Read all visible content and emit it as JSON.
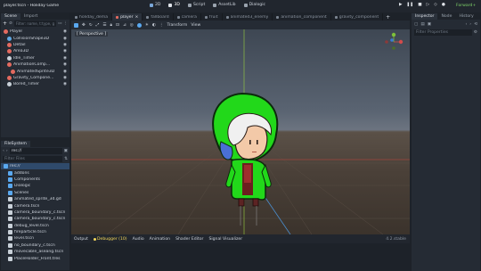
{
  "window": {
    "title": "player.tscn - Holiday Game",
    "center_tabs": [
      "2D",
      "3D",
      "Script",
      "AssetLib",
      "Dialogic"
    ],
    "renderer": "Forward+"
  },
  "scene_dock": {
    "tabs": [
      "Scene",
      "Import"
    ],
    "filter_placeholder": "Filter: name, t:type, g",
    "nodes": [
      {
        "label": "Player",
        "color": "#e46a5f",
        "level": 0
      },
      {
        "label": "CollisionShape3D",
        "color": "#5fa8e4",
        "level": 1
      },
      {
        "label": "Detail",
        "color": "#e46a5f",
        "level": 1
      },
      {
        "label": "Area3D",
        "color": "#e46a5f",
        "level": 1
      },
      {
        "label": "Idle_Timer",
        "color": "#c9d1d9",
        "level": 1
      },
      {
        "label": "AnimationComp...",
        "color": "#e46a5f",
        "level": 1
      },
      {
        "label": "AnimatedSprite3D",
        "color": "#e46a5f",
        "level": 2
      },
      {
        "label": "Gravity_Compone...",
        "color": "#e46a5f",
        "level": 1
      },
      {
        "label": "Bored_Timer",
        "color": "#c9d1d9",
        "level": 1
      }
    ]
  },
  "filesystem": {
    "title": "FileSystem",
    "path": "res://",
    "filter_placeholder": "Filter Files",
    "items": [
      {
        "label": "res://",
        "type": "folder",
        "level": 0,
        "selected": true
      },
      {
        "label": "addons",
        "type": "folder",
        "level": 1
      },
      {
        "label": "Components",
        "type": "folder",
        "level": 1
      },
      {
        "label": "Dialogic",
        "type": "folder",
        "level": 1
      },
      {
        "label": "Scenes",
        "type": "folder",
        "level": 1
      },
      {
        "label": "animated_sprite_3d.gd",
        "type": "file",
        "level": 1
      },
      {
        "label": "camera.tscn",
        "type": "file",
        "level": 1
      },
      {
        "label": "camera_boundary_c.tscn",
        "type": "file",
        "level": 1
      },
      {
        "label": "camera_boundary_c.tscn",
        "type": "file",
        "level": 1
      },
      {
        "label": "debug_level.tscn",
        "type": "file",
        "level": 1
      },
      {
        "label": "fireparticle.tscn",
        "type": "file",
        "level": 1
      },
      {
        "label": "level.tscn",
        "type": "file",
        "level": 1
      },
      {
        "label": "no_boundary_c.tscn",
        "type": "file",
        "level": 1
      },
      {
        "label": "movecable_aseang.tscn",
        "type": "file",
        "level": 1
      },
      {
        "label": "PlaceHolder_Front.tres",
        "type": "file",
        "level": 1
      }
    ]
  },
  "editor_tabs": [
    {
      "label": "holiday_dema",
      "active": false
    },
    {
      "label": "player",
      "active": true
    },
    {
      "label": "fallboard",
      "active": false
    },
    {
      "label": "camera",
      "active": false
    },
    {
      "label": "fruit",
      "active": false
    },
    {
      "label": "animated3_enemy",
      "active": false
    },
    {
      "label": "animation_component",
      "active": false
    },
    {
      "label": "gravity_component",
      "active": false
    }
  ],
  "viewport_toolbar": {
    "transform_label": "Transform",
    "view_label": "View"
  },
  "viewport": {
    "perspective_label": "[ Perspective ]"
  },
  "bottom_panel": {
    "tabs": [
      "Output",
      "Debugger (10)",
      "Audio",
      "Animation",
      "Shader Editor",
      "Signal Visualizer"
    ],
    "version": "4.2.stable"
  },
  "inspector": {
    "tabs": [
      "Inspector",
      "Node",
      "History"
    ],
    "filter_placeholder": "Filter Properties"
  },
  "colors": {
    "accent": "#5aa9f0",
    "node_3d": "#e46a5f",
    "character_green": "#22d81a"
  }
}
